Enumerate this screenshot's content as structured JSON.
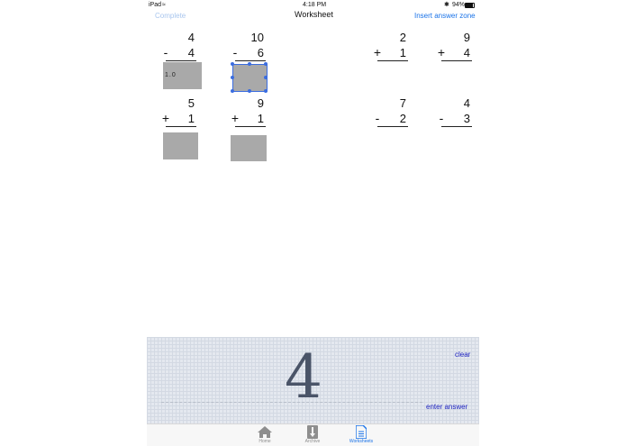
{
  "status_bar": {
    "device": "iPad",
    "time": "4:18 PM",
    "battery": "94%"
  },
  "nav": {
    "left_label": "Complete",
    "title": "Worksheet",
    "right_label": "Insert answer zone"
  },
  "problems": [
    {
      "top": "4",
      "operator": "-",
      "bottom": "4",
      "answer_value": "1.0"
    },
    {
      "top": "10",
      "operator": "-",
      "bottom": "6"
    },
    {
      "top": "5",
      "operator": "+",
      "bottom": "1"
    },
    {
      "top": "9",
      "operator": "+",
      "bottom": "1"
    },
    {
      "top": "2",
      "operator": "+",
      "bottom": "1"
    },
    {
      "top": "9",
      "operator": "+",
      "bottom": "4"
    },
    {
      "top": "7",
      "operator": "-",
      "bottom": "2"
    },
    {
      "top": "4",
      "operator": "-",
      "bottom": "3"
    }
  ],
  "input_panel": {
    "digit": "4",
    "clear_label": "clear",
    "enter_label": "enter answer"
  },
  "tabs": [
    {
      "label": "Home",
      "icon": "home-icon",
      "active": false
    },
    {
      "label": "Archive",
      "icon": "archive-icon",
      "active": false
    },
    {
      "label": "Worksheets",
      "icon": "document-icon",
      "active": true
    }
  ],
  "colors": {
    "accent": "#1a73e8",
    "panel_link": "#1a1fbf",
    "answer_box": "#a9a9a9",
    "selection": "#3b6de0"
  }
}
